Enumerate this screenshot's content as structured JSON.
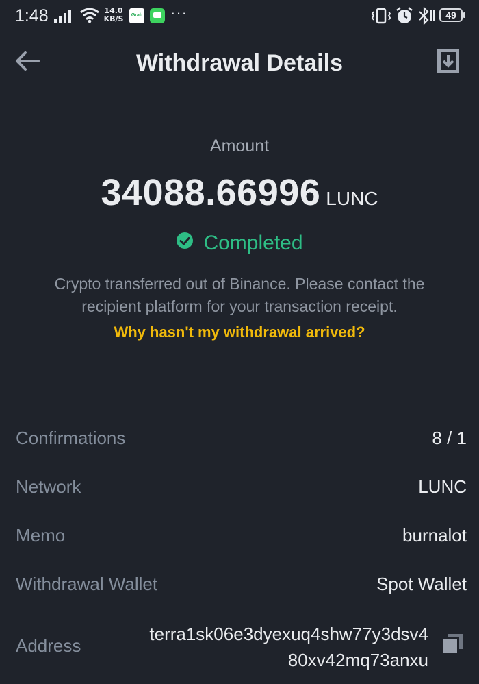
{
  "status_bar": {
    "time": "1:48",
    "net_speed_value": "14.0",
    "net_speed_unit": "KB/S",
    "app_icon_label": "Grab",
    "more": "···",
    "battery": "49"
  },
  "header": {
    "title": "Withdrawal Details"
  },
  "summary": {
    "amount_label": "Amount",
    "amount": "34088.66996",
    "unit": "LUNC",
    "status": "Completed",
    "notice": "Crypto transferred out of Binance. Please contact the recipient platform for your transaction receipt.",
    "help_link": "Why hasn't my withdrawal arrived?"
  },
  "details": [
    {
      "label": "Confirmations",
      "value": "8 / 1"
    },
    {
      "label": "Network",
      "value": "LUNC"
    },
    {
      "label": "Memo",
      "value": "burnalot"
    },
    {
      "label": "Withdrawal Wallet",
      "value": "Spot Wallet"
    },
    {
      "label": "Address",
      "value": "terra1sk06e3dyexuq4shw77y3dsv480xv42mq73anxu"
    }
  ],
  "colors": {
    "background": "#1f232b",
    "success": "#2ebd85",
    "link": "#f0b90b",
    "label": "#848e9c"
  },
  "icons": {
    "back": "arrow-left-icon",
    "download": "download-icon",
    "status": "check-circle-icon",
    "copy": "copy-icon"
  }
}
